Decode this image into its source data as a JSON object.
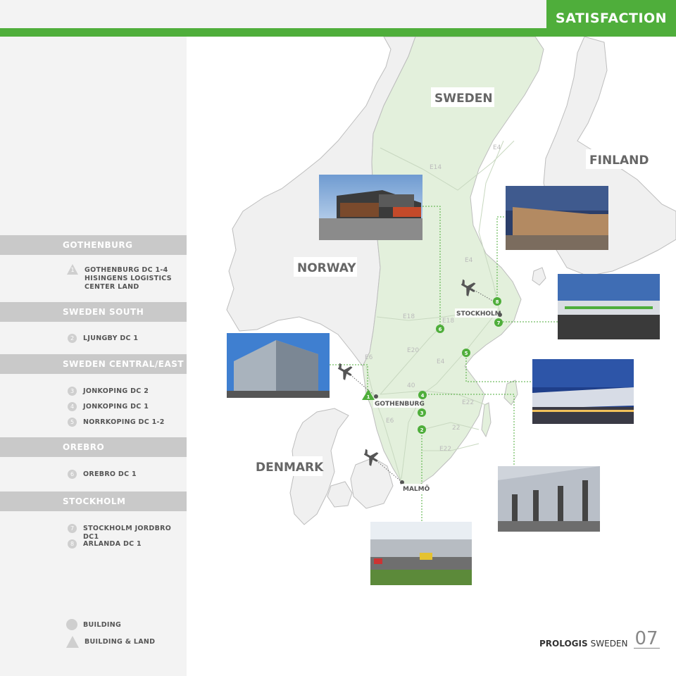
{
  "header": {
    "section_title": "SATISFACTION"
  },
  "regions": [
    {
      "name": "GOTHENBURG",
      "sites": [
        {
          "num": "1",
          "shape": "triangle",
          "label": "GOTHENBURG DC 1-4 HISINGENS LOGISTICS CENTER LAND"
        }
      ]
    },
    {
      "name": "SWEDEN SOUTH",
      "sites": [
        {
          "num": "2",
          "shape": "circle",
          "label": "LJUNGBY DC 1"
        }
      ]
    },
    {
      "name": "SWEDEN CENTRAL/EAST",
      "sites": [
        {
          "num": "3",
          "shape": "circle",
          "label": "JONKOPING DC 2"
        },
        {
          "num": "4",
          "shape": "circle",
          "label": "JONKOPING DC 1"
        },
        {
          "num": "5",
          "shape": "circle",
          "label": "NORRKOPING DC 1-2"
        }
      ]
    },
    {
      "name": "OREBRO",
      "sites": [
        {
          "num": "6",
          "shape": "circle",
          "label": "OREBRO DC 1"
        }
      ]
    },
    {
      "name": "STOCKHOLM",
      "sites": [
        {
          "num": "7",
          "shape": "circle",
          "label": "STOCKHOLM JORDBRO DC1"
        },
        {
          "num": "8",
          "shape": "circle",
          "label": "ARLANDA DC 1"
        }
      ]
    }
  ],
  "legend": {
    "building": "BUILDING",
    "building_land": "BUILDING & LAND"
  },
  "map": {
    "countries": {
      "sweden": "SWEDEN",
      "finland": "FINLAND",
      "norway": "NORWAY",
      "denmark": "DENMARK"
    },
    "cities": {
      "stockholm": "STOCKHOLM",
      "gothenburg": "GOTHENBURG",
      "malmo": "MALMÖ"
    },
    "roads": {
      "e4": "E4",
      "e14": "E14",
      "e18": "E18",
      "e20": "E20",
      "e6": "E6",
      "e22": "E22",
      "r40": "40",
      "r22": "22"
    },
    "markers": {
      "m1": "1",
      "m2": "2",
      "m3": "3",
      "m4": "4",
      "m5": "5",
      "m6": "6",
      "m7": "7",
      "m8": "8"
    },
    "colors": {
      "sweden_land": "#e3f0dc",
      "other_land": "#f0f0f0",
      "coast": "#bdbdbd",
      "marker": "#4fae3b"
    }
  },
  "footer": {
    "brand": "PROLOGIS",
    "country": "SWEDEN",
    "page": "07"
  }
}
